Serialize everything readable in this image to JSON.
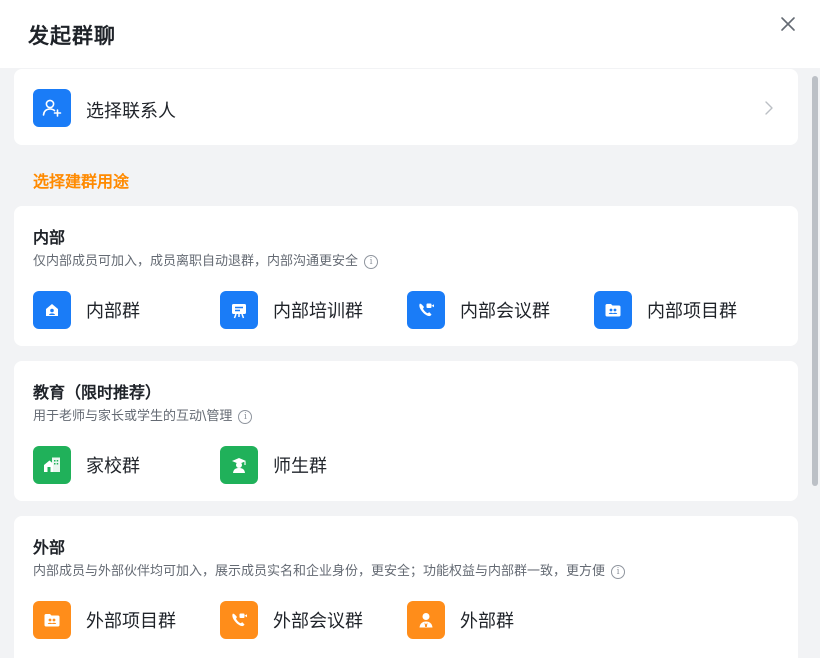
{
  "dialog": {
    "title": "发起群聊"
  },
  "contact": {
    "label": "选择联系人"
  },
  "section_title": "选择建群用途",
  "groups": {
    "internal": {
      "title": "内部",
      "desc": "仅内部成员可加入，成员离职自动退群，内部沟通更安全",
      "options": [
        {
          "label": "内部群",
          "icon": "building-icon",
          "color": "#1a7cf7"
        },
        {
          "label": "内部培训群",
          "icon": "training-board-icon",
          "color": "#1a7cf7"
        },
        {
          "label": "内部会议群",
          "icon": "video-phone-icon",
          "color": "#1a7cf7"
        },
        {
          "label": "内部项目群",
          "icon": "project-folder-icon",
          "color": "#1a7cf7"
        }
      ]
    },
    "education": {
      "title": "教育（限时推荐）",
      "desc": "用于老师与家长或学生的互动\\管理",
      "options": [
        {
          "label": "家校群",
          "icon": "school-house-icon",
          "color": "#20b15a"
        },
        {
          "label": "师生群",
          "icon": "graduate-icon",
          "color": "#20b15a"
        }
      ]
    },
    "external": {
      "title": "外部",
      "desc": "内部成员与外部伙伴均可加入，展示成员实名和企业身份，更安全；功能权益与内部群一致，更方便",
      "options": [
        {
          "label": "外部项目群",
          "icon": "project-folder-icon",
          "color": "#ff8d1a"
        },
        {
          "label": "外部会议群",
          "icon": "video-phone-icon",
          "color": "#ff8d1a"
        },
        {
          "label": "外部群",
          "icon": "person-badge-icon",
          "color": "#ff8d1a"
        }
      ]
    }
  }
}
